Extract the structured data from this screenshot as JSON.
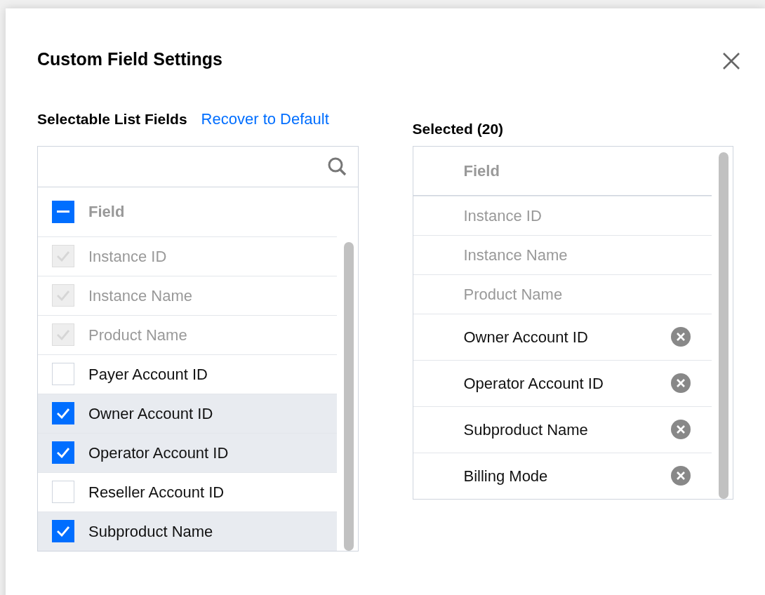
{
  "dialog": {
    "title": "Custom Field Settings"
  },
  "selectable": {
    "heading": "Selectable List Fields",
    "reset_link": "Recover to Default",
    "header": {
      "label": "Field",
      "checked": true,
      "indeterminate": true
    },
    "items": [
      {
        "label": "Instance ID",
        "checked": true,
        "disabled": true
      },
      {
        "label": "Instance Name",
        "checked": true,
        "disabled": true
      },
      {
        "label": "Product Name",
        "checked": true,
        "disabled": true
      },
      {
        "label": "Payer Account ID",
        "checked": false,
        "disabled": false
      },
      {
        "label": "Owner Account ID",
        "checked": true,
        "disabled": false
      },
      {
        "label": "Operator Account ID",
        "checked": true,
        "disabled": false
      },
      {
        "label": "Reseller Account ID",
        "checked": false,
        "disabled": false
      },
      {
        "label": "Subproduct Name",
        "checked": true,
        "disabled": false
      }
    ]
  },
  "selected": {
    "heading": "Selected (20)",
    "header": "Field",
    "items": [
      {
        "label": "Instance ID",
        "removable": false
      },
      {
        "label": "Instance Name",
        "removable": false
      },
      {
        "label": "Product Name",
        "removable": false
      },
      {
        "label": "Owner Account ID",
        "removable": true
      },
      {
        "label": "Operator Account ID",
        "removable": true
      },
      {
        "label": "Subproduct Name",
        "removable": true
      },
      {
        "label": "Billing Mode",
        "removable": true
      }
    ]
  }
}
